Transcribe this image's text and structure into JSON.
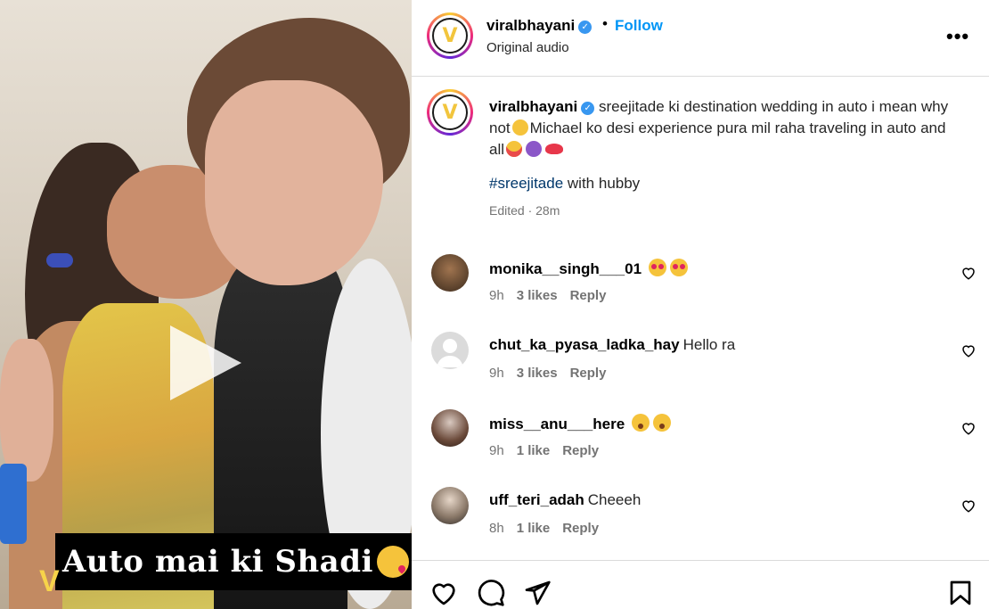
{
  "media": {
    "caption_overlay": "Auto mai ki Shadi",
    "caption_emoji": "face-blowing-kiss",
    "watermark_icon": "viral-bhayani-logo"
  },
  "header": {
    "username": "viralbhayani",
    "verified": true,
    "separator": "•",
    "follow_label": "Follow",
    "audio_label": "Original audio"
  },
  "caption": {
    "username": "viralbhayani",
    "text_part1": "sreejitade ki destination wedding in auto i mean why not",
    "text_part2": "Michael ko desi experience pura mil raha traveling in auto and all",
    "hashtag": "#sreejitade",
    "hashtag_suffix": "with hubby",
    "meta": "Edited · 28m"
  },
  "comments": [
    {
      "username": "monika__singh___01",
      "text": "",
      "emojis": [
        "heart-eyes",
        "heart-eyes"
      ],
      "time": "9h",
      "likes": "3 likes",
      "reply": "Reply"
    },
    {
      "username": "chut_ka_pyasa_ladka_hay",
      "text": "Hello ra",
      "emojis": [],
      "time": "9h",
      "likes": "3 likes",
      "reply": "Reply"
    },
    {
      "username": "miss__anu___here",
      "text": "",
      "emojis": [
        "astonished",
        "astonished"
      ],
      "time": "9h",
      "likes": "1 like",
      "reply": "Reply"
    },
    {
      "username": "uff_teri_adah",
      "text": "Cheeeh",
      "emojis": [],
      "time": "8h",
      "likes": "1 like",
      "reply": "Reply"
    }
  ],
  "colors": {
    "follow_blue": "#0095f6",
    "hashtag": "#00376b",
    "meta_gray": "#737373",
    "divider": "#dbdbdb"
  }
}
